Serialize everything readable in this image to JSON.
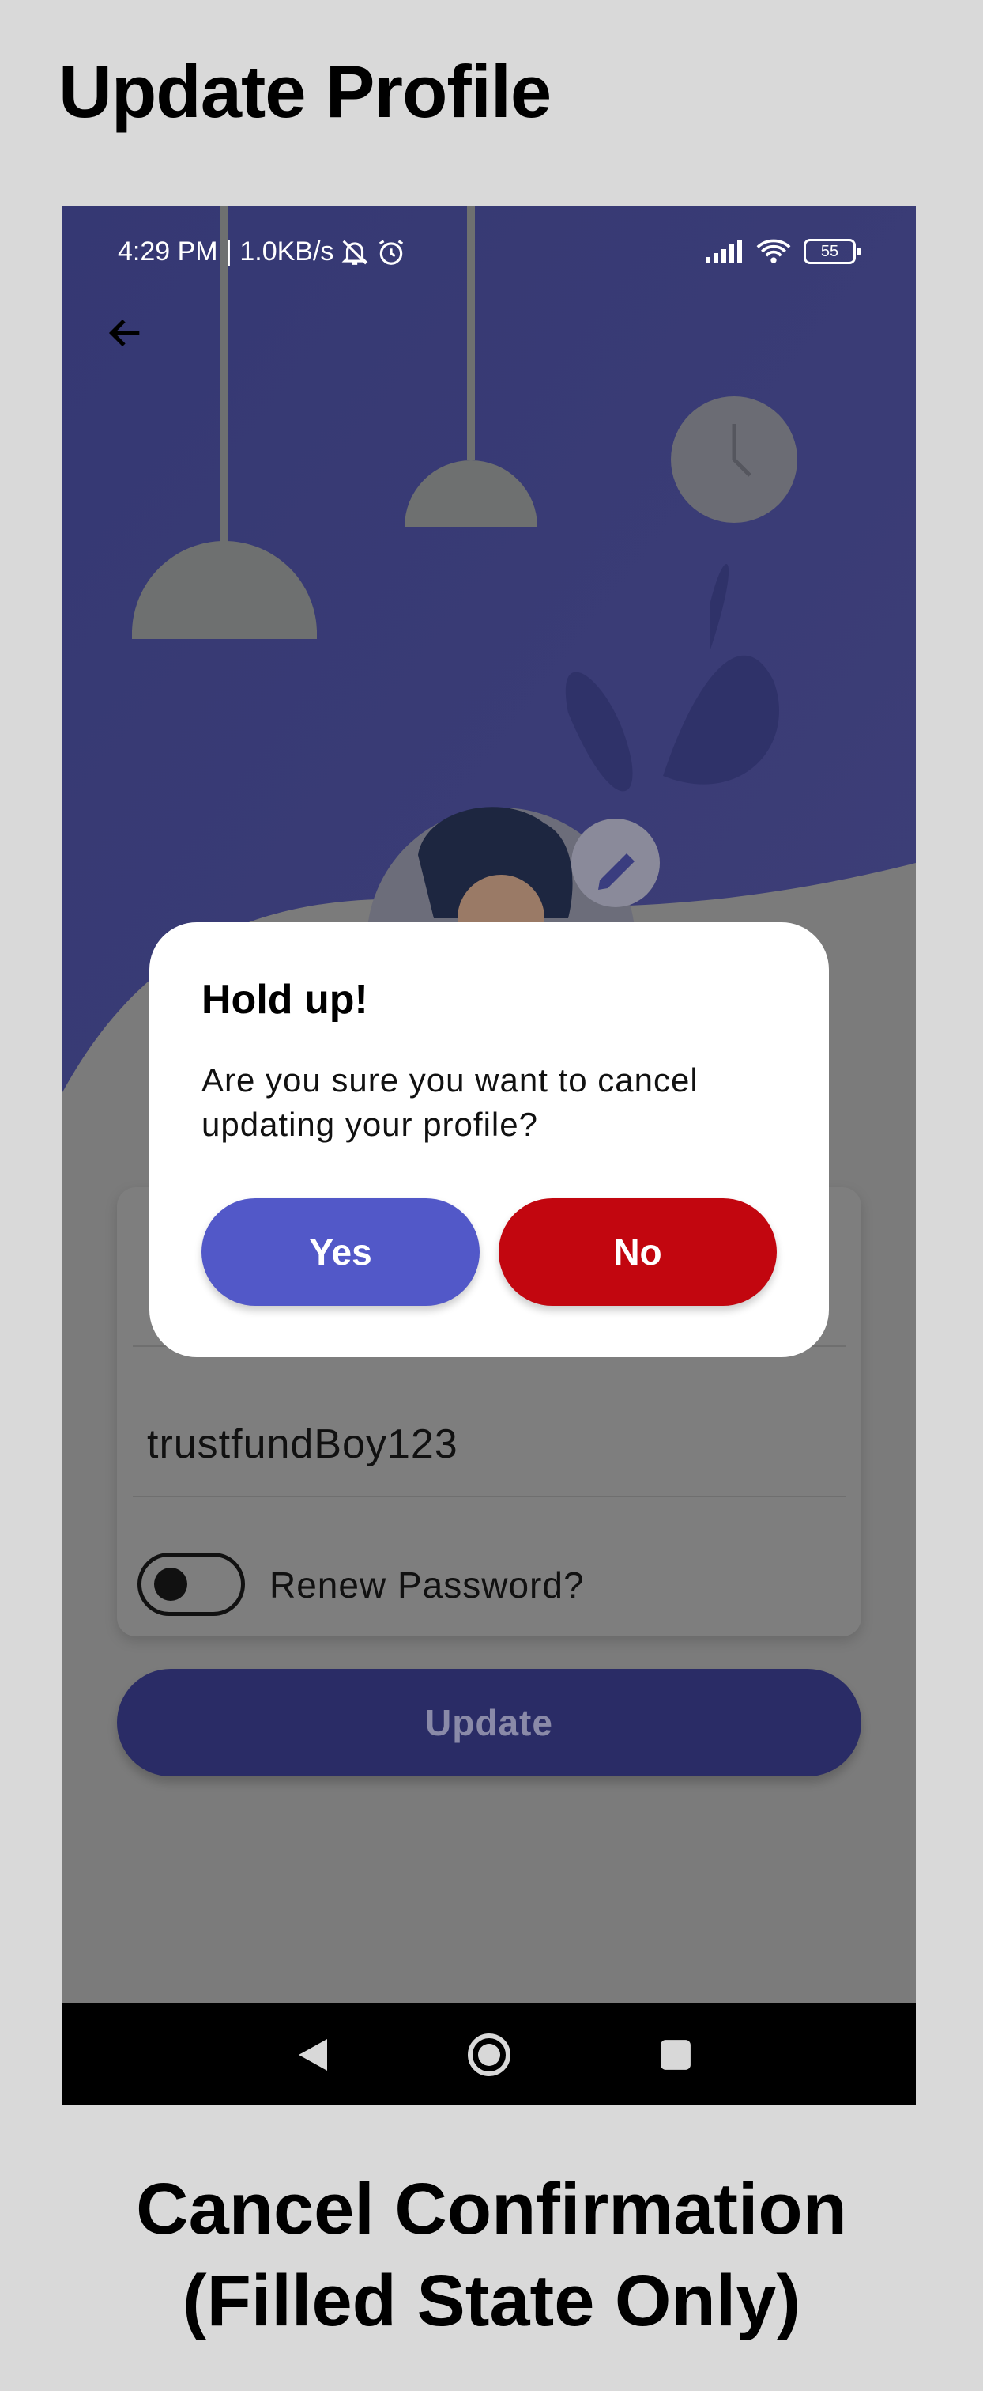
{
  "heading": "Update Profile",
  "caption_line1": "Cancel Confirmation",
  "caption_line2": "(Filled State Only)",
  "status_bar": {
    "time_info": "4:29 PM | 1.0KB/s",
    "battery": "55"
  },
  "form": {
    "username_value": "trustfundBoy123",
    "renew_password_label": "Renew Password?",
    "renew_password_on": false,
    "update_label": "Update"
  },
  "dialog": {
    "title": "Hold up!",
    "message": "Are you sure you want to cancel updating your profile?",
    "yes_label": "Yes",
    "no_label": "No"
  },
  "colors": {
    "primary": "#5258c8",
    "danger": "#c2060f",
    "hero_background": "#3a3d7f"
  },
  "icons": [
    "arrow-left-icon",
    "edit-pencil-icon",
    "mute-bell-icon",
    "alarm-icon",
    "signal-icon",
    "wifi-icon",
    "battery-icon",
    "nav-back-icon",
    "nav-home-icon",
    "nav-recents-icon"
  ]
}
